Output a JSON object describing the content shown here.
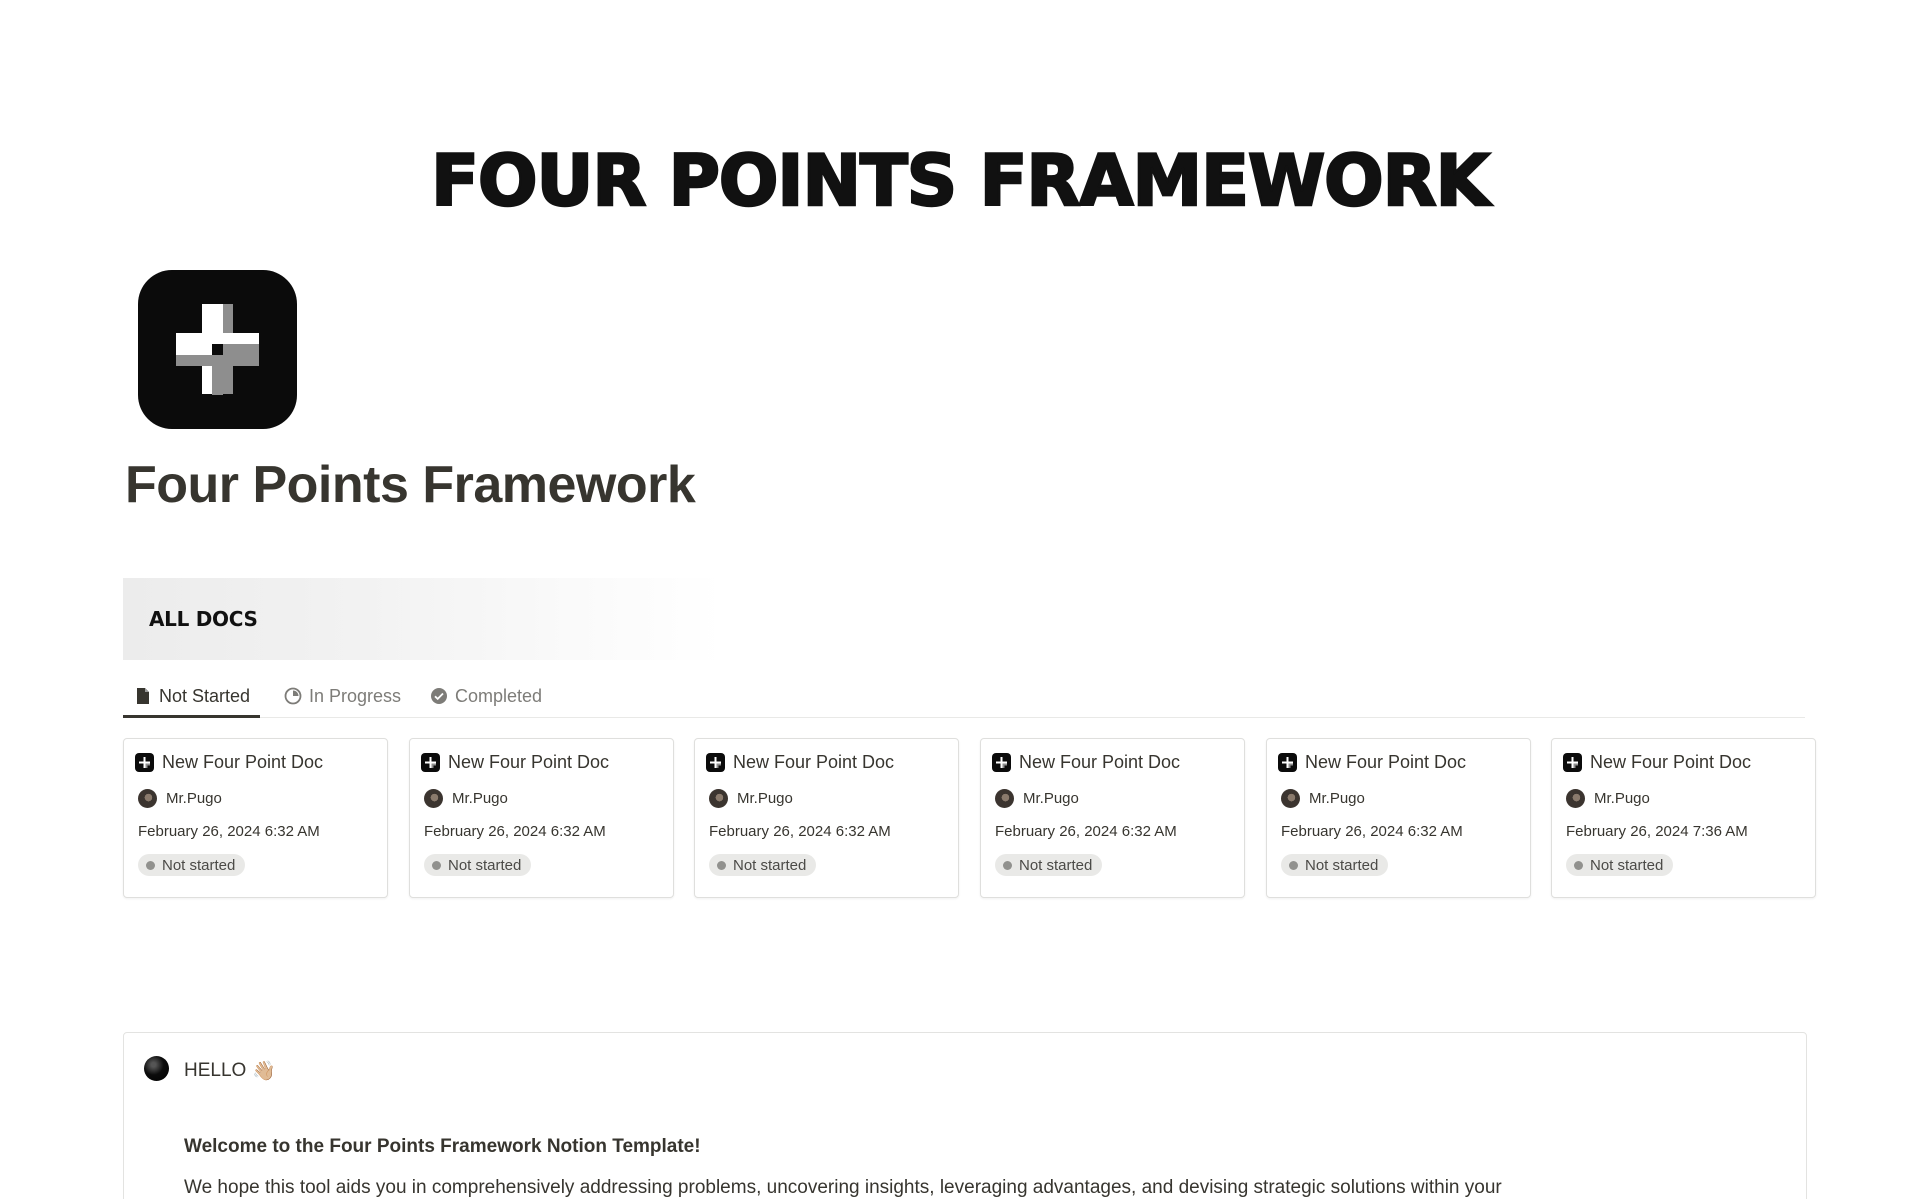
{
  "banner": {
    "text": "FOUR POINTS FRAMEWORK"
  },
  "page": {
    "title": "Four Points Framework",
    "icon": "four-points-icon"
  },
  "section": {
    "title": "ALL DOCS"
  },
  "tabs": [
    {
      "label": "Not Started",
      "icon": "document-icon",
      "active": true
    },
    {
      "label": "In Progress",
      "icon": "progress-circle-icon",
      "active": false
    },
    {
      "label": "Completed",
      "icon": "check-circle-icon",
      "active": false
    }
  ],
  "cards": [
    {
      "title": "New Four Point Doc",
      "user": "Mr.Pugo",
      "date": "February 26, 2024 6:32 AM",
      "status": "Not started"
    },
    {
      "title": "New Four Point Doc",
      "user": "Mr.Pugo",
      "date": "February 26, 2024 6:32 AM",
      "status": "Not started"
    },
    {
      "title": "New Four Point Doc",
      "user": "Mr.Pugo",
      "date": "February 26, 2024 6:32 AM",
      "status": "Not started"
    },
    {
      "title": "New Four Point Doc",
      "user": "Mr.Pugo",
      "date": "February 26, 2024 6:32 AM",
      "status": "Not started"
    },
    {
      "title": "New Four Point Doc",
      "user": "Mr.Pugo",
      "date": "February 26, 2024 6:32 AM",
      "status": "Not started"
    },
    {
      "title": "New Four Point Doc",
      "user": "Mr.Pugo",
      "date": "February 26, 2024 7:36 AM",
      "status": "Not started"
    }
  ],
  "callout": {
    "heading": "HELLO",
    "heading_emoji": "👋🏼",
    "welcome": "Welcome to the Four Points Framework Notion Template!",
    "body": "We hope this tool aids you in comprehensively addressing problems, uncovering insights, leveraging advantages, and devising strategic solutions within your"
  },
  "colors": {
    "text": "#37352f",
    "muted": "#7d7c78",
    "badge_bg": "#e9e9e7",
    "icon_bg": "#0b0b0b"
  }
}
